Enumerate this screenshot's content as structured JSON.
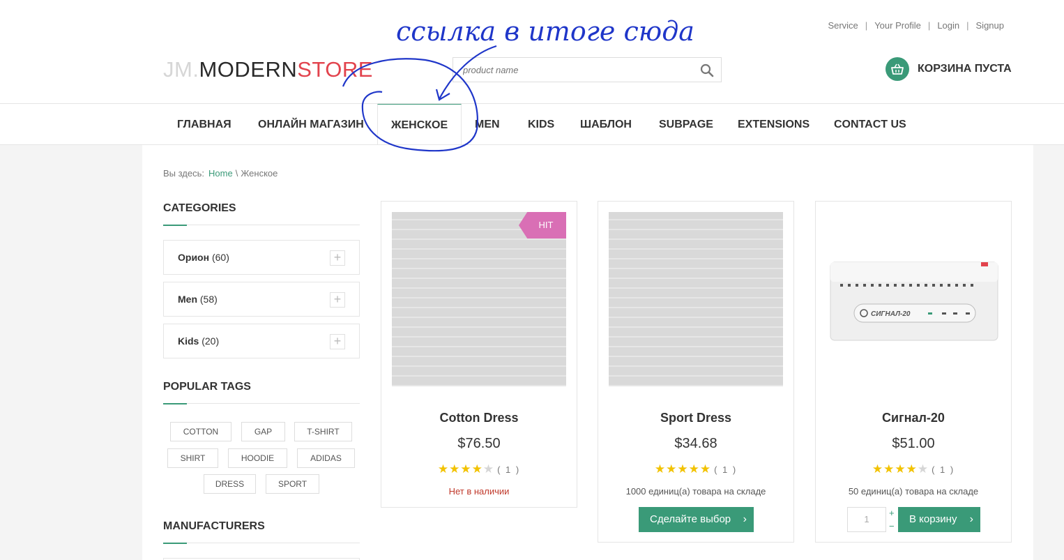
{
  "header": {
    "top_links": [
      "Service",
      "Your Profile",
      "Login",
      "Signup"
    ],
    "logo": {
      "jm": "JM.",
      "modern": "MODERN",
      "store": "STORE"
    },
    "search": {
      "placeholder": "product name",
      "icon": "search-icon"
    },
    "cart": {
      "label": "КОРЗИНА ПУСТА",
      "icon": "basket-icon"
    }
  },
  "nav": {
    "items": [
      "ГЛАВНАЯ",
      "ОНЛАЙН МАГАЗИН",
      "ЖЕНСКОЕ",
      "MEN",
      "KIDS",
      "ШАБЛОН",
      "SUBPAGE",
      "EXTENSIONS",
      "CONTACT US"
    ],
    "active_index": 2
  },
  "breadcrumb": {
    "prefix": "Вы здесь:",
    "home": "Home",
    "separator": "\\",
    "current": "Женское"
  },
  "sidebar": {
    "categories_title": "CATEGORIES",
    "categories": [
      {
        "name": "Орион",
        "count": "(60)"
      },
      {
        "name": "Men",
        "count": "(58)"
      },
      {
        "name": "Kids",
        "count": "(20)"
      }
    ],
    "tags_title": "POPULAR TAGS",
    "tags": [
      "COTTON",
      "GAP",
      "T-SHIRT",
      "SHIRT",
      "HOODIE",
      "ADIDAS",
      "DRESS",
      "SPORT"
    ],
    "manufacturers_title": "MANUFACTURERS"
  },
  "products": [
    {
      "title": "Cotton Dress",
      "price": "$76.50",
      "rating": 4,
      "rating_count": "( 1 )",
      "badge": "HIT",
      "stock": "Нет в наличии",
      "in_stock": false
    },
    {
      "title": "Sport Dress",
      "price": "$34.68",
      "rating": 5,
      "rating_count": "( 1 )",
      "stock": "1000 единиц(а) товара на складе",
      "in_stock": true,
      "button": "Сделайте выбор"
    },
    {
      "title": "Сигнал-20",
      "price": "$51.00",
      "rating": 4,
      "rating_count": "( 1 )",
      "stock": "50 единиц(а) товара на складе",
      "in_stock": true,
      "qty": "1",
      "button": "В корзину",
      "device_label": "СИГНАЛ-20"
    }
  ],
  "annotation": {
    "text": "ссылка в итоге сюда",
    "color": "#1f36c9"
  },
  "colors": {
    "accent": "#3a9a78",
    "logo_red": "#e2434d",
    "badge": "#d96fb5",
    "star": "#f2c200",
    "out_of_stock": "#c0392b"
  }
}
